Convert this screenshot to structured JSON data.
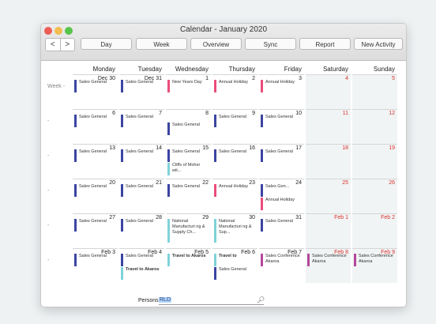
{
  "window": {
    "title": "Calendar - January 2020",
    "dots": [
      "#ee5d55",
      "#f3bd4f",
      "#59c44b"
    ]
  },
  "toolbar": {
    "back_glyph": "<",
    "forward_glyph": ">",
    "buttons": [
      "Day",
      "Week",
      "Overview",
      "Sync",
      "Report",
      "New Activity"
    ]
  },
  "grid": {
    "weekday_labels": [
      "Monday",
      "Tuesday",
      "Wednesday",
      "Thursday",
      "Friday",
      "Saturday",
      "Sunday"
    ],
    "week_labels": [
      "Week -",
      "-",
      "-",
      "-",
      "-",
      "-"
    ],
    "weeks": [
      [
        {
          "date": "Dec 30",
          "events": [
            {
              "text": "Sales General",
              "color": "#3b45a2"
            }
          ]
        },
        {
          "date": "Dec 31",
          "events": [
            {
              "text": "Sales General",
              "color": "#3b45a2"
            }
          ]
        },
        {
          "date": "1",
          "events": [
            {
              "text": "New Years Day",
              "color": "#ea4d7a"
            }
          ]
        },
        {
          "date": "2",
          "events": [
            {
              "text": "Annual Holiday",
              "color": "#ea4d7a"
            }
          ]
        },
        {
          "date": "3",
          "events": [
            {
              "text": "Annual Holiday",
              "color": "#ea4d7a"
            }
          ]
        },
        {
          "date": "4",
          "red": true,
          "events": []
        },
        {
          "date": "5",
          "red": true,
          "events": []
        }
      ],
      [
        {
          "date": "6",
          "events": [
            {
              "text": "Sales General",
              "color": "#3b45a2"
            }
          ]
        },
        {
          "date": "7",
          "events": [
            {
              "text": "Sales General",
              "color": "#3b45a2"
            }
          ]
        },
        {
          "date": "8",
          "events": [
            {
              "text": "Sales General",
              "color": "#3b45a2",
              "offset": true
            }
          ]
        },
        {
          "date": "9",
          "events": [
            {
              "text": "Sales General",
              "color": "#3b45a2"
            }
          ]
        },
        {
          "date": "10",
          "events": [
            {
              "text": "Sales General",
              "color": "#3b45a2"
            }
          ]
        },
        {
          "date": "11",
          "red": true,
          "events": []
        },
        {
          "date": "12",
          "red": true,
          "events": []
        }
      ],
      [
        {
          "date": "13",
          "events": [
            {
              "text": "Sales General",
              "color": "#3b45a2"
            }
          ]
        },
        {
          "date": "14",
          "events": [
            {
              "text": "Sales General",
              "color": "#3b45a2"
            }
          ]
        },
        {
          "date": "15",
          "events": [
            {
              "text": "Sales General",
              "color": "#3b45a2"
            },
            {
              "text": "Cliffs of Moher wit...",
              "color": "#7ed3d9"
            }
          ]
        },
        {
          "date": "16",
          "events": [
            {
              "text": "Sales General",
              "color": "#3b45a2"
            }
          ]
        },
        {
          "date": "17",
          "events": [
            {
              "text": "Sales General",
              "color": "#3b45a2"
            }
          ]
        },
        {
          "date": "18",
          "red": true,
          "events": []
        },
        {
          "date": "19",
          "red": true,
          "events": []
        }
      ],
      [
        {
          "date": "20",
          "events": [
            {
              "text": "Sales General",
              "color": "#3b45a2"
            }
          ]
        },
        {
          "date": "21",
          "events": [
            {
              "text": "Sales General",
              "color": "#3b45a2"
            }
          ]
        },
        {
          "date": "22",
          "events": [
            {
              "text": "Sales General",
              "color": "#3b45a2"
            }
          ]
        },
        {
          "date": "23",
          "events": [
            {
              "text": "Annual Holiday",
              "color": "#ea4d7a"
            }
          ]
        },
        {
          "date": "24",
          "events": [
            {
              "text": "Sales Gen...",
              "color": "#3b45a2"
            },
            {
              "text": "Annual Holiday",
              "color": "#ea4d7a"
            }
          ]
        },
        {
          "date": "25",
          "red": true,
          "events": []
        },
        {
          "date": "26",
          "red": true,
          "events": []
        }
      ],
      [
        {
          "date": "27",
          "events": [
            {
              "text": "Sales General",
              "color": "#3b45a2"
            }
          ]
        },
        {
          "date": "28",
          "events": [
            {
              "text": "Sales General",
              "color": "#3b45a2"
            }
          ]
        },
        {
          "date": "29",
          "events": [
            {
              "text": "National Manufacturi ng & Supply Ch...",
              "color": "#7ed3d9"
            }
          ]
        },
        {
          "date": "30",
          "events": [
            {
              "text": "National Manufacturi ng & Sup...",
              "color": "#7ed3d9"
            }
          ]
        },
        {
          "date": "31",
          "events": [
            {
              "text": "Sales General",
              "color": "#3b45a2"
            }
          ]
        },
        {
          "date": "Feb 1",
          "red": true,
          "events": []
        },
        {
          "date": "Feb 2",
          "red": true,
          "events": []
        }
      ],
      [
        {
          "date": "Feb 3",
          "events": [
            {
              "text": "Sales General",
              "color": "#3b45a2"
            }
          ]
        },
        {
          "date": "Feb 4",
          "events": [
            {
              "text": "Sales General",
              "color": "#3b45a2"
            },
            {
              "text": "Travel to Akaros",
              "color": "#7ed3d9",
              "strong": true
            }
          ]
        },
        {
          "date": "Feb 5",
          "events": [
            {
              "text": "Travel to Akaros",
              "color": "#7ed3d9",
              "strong": true
            }
          ]
        },
        {
          "date": "Feb 6",
          "events": [
            {
              "text": "Travel to",
              "color": "#7ed3d9",
              "strong": true
            },
            {
              "text": "Sales General",
              "color": "#3b45a2"
            }
          ]
        },
        {
          "date": "Feb 7",
          "events": [
            {
              "text": "Sales Conference Akaroa",
              "color": "#b5479b"
            }
          ]
        },
        {
          "date": "Feb 8",
          "red": true,
          "events": [
            {
              "text": "Sales Conference Akaroa",
              "color": "#b5479b"
            }
          ]
        },
        {
          "date": "Feb 9",
          "red": true,
          "events": [
            {
              "text": "Sales Conference Akaroa",
              "color": "#b5479b"
            }
          ]
        }
      ]
    ]
  },
  "persons": {
    "label": "Persons",
    "value": "RLD",
    "search_icon": "magnifier-icon"
  }
}
